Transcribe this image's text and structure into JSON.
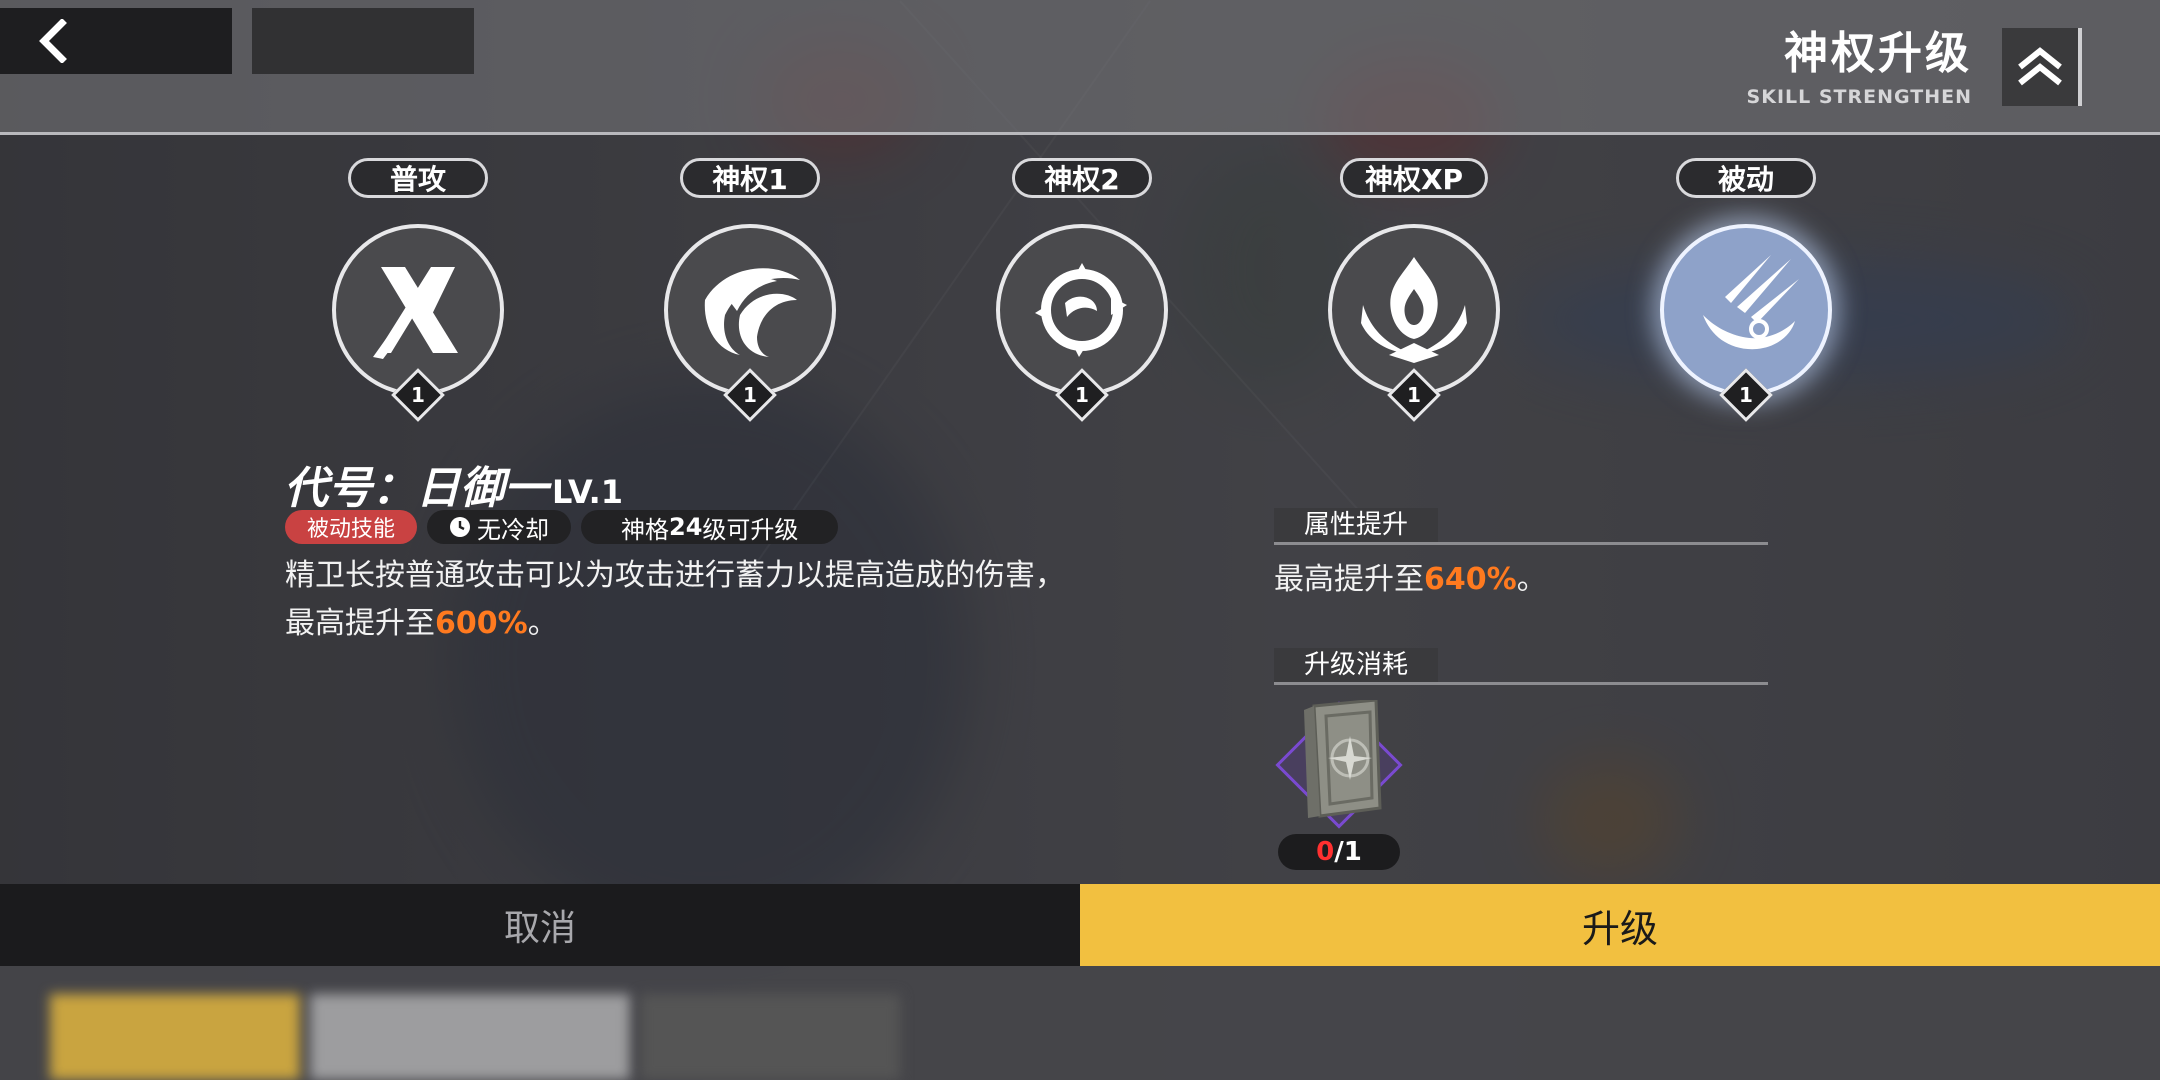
{
  "header": {
    "title": "神权升级",
    "subtitle": "SKILL STRENGTHEN",
    "back_icon": "chevron-left-icon",
    "toggle_icon": "double-chevron-up-icon"
  },
  "skills": [
    {
      "tab": "普攻",
      "level": "1",
      "icon": "crossed-blades-icon"
    },
    {
      "tab": "神权1",
      "level": "1",
      "icon": "flame-swirl-icon"
    },
    {
      "tab": "神权2",
      "level": "1",
      "icon": "thorn-orb-icon"
    },
    {
      "tab": "神权XP",
      "level": "1",
      "icon": "blaze-emblem-icon"
    },
    {
      "tab": "被动",
      "level": "1",
      "icon": "claw-strike-icon",
      "selected": true
    }
  ],
  "detail": {
    "name": "代号：日御一",
    "level": "LV.1",
    "tags": {
      "type": "被动技能",
      "cooldown": "无冷却",
      "requirement_prefix": "神格",
      "requirement_level": "24",
      "requirement_suffix": "级可升级"
    },
    "desc_line1": "精卫长按普通攻击可以为攻击进行蓄力以提高造成的伤害，",
    "desc_line2_prefix": "最高提升至",
    "desc_line2_value": "600%",
    "desc_line2_suffix": "。"
  },
  "attribute": {
    "header": "属性提升",
    "text_prefix": "最高提升至",
    "value": "640%",
    "text_suffix": "。"
  },
  "cost": {
    "header": "升级消耗",
    "item_icon": "skill-book-icon",
    "owned": "0",
    "required": "/1"
  },
  "buttons": {
    "cancel": "取消",
    "upgrade": "升级"
  },
  "colors": {
    "accent_yellow": "#f2c040",
    "highlight_orange": "#ff7a1f",
    "tag_red": "#c94242",
    "selected_skill": "#8ea2c9"
  }
}
